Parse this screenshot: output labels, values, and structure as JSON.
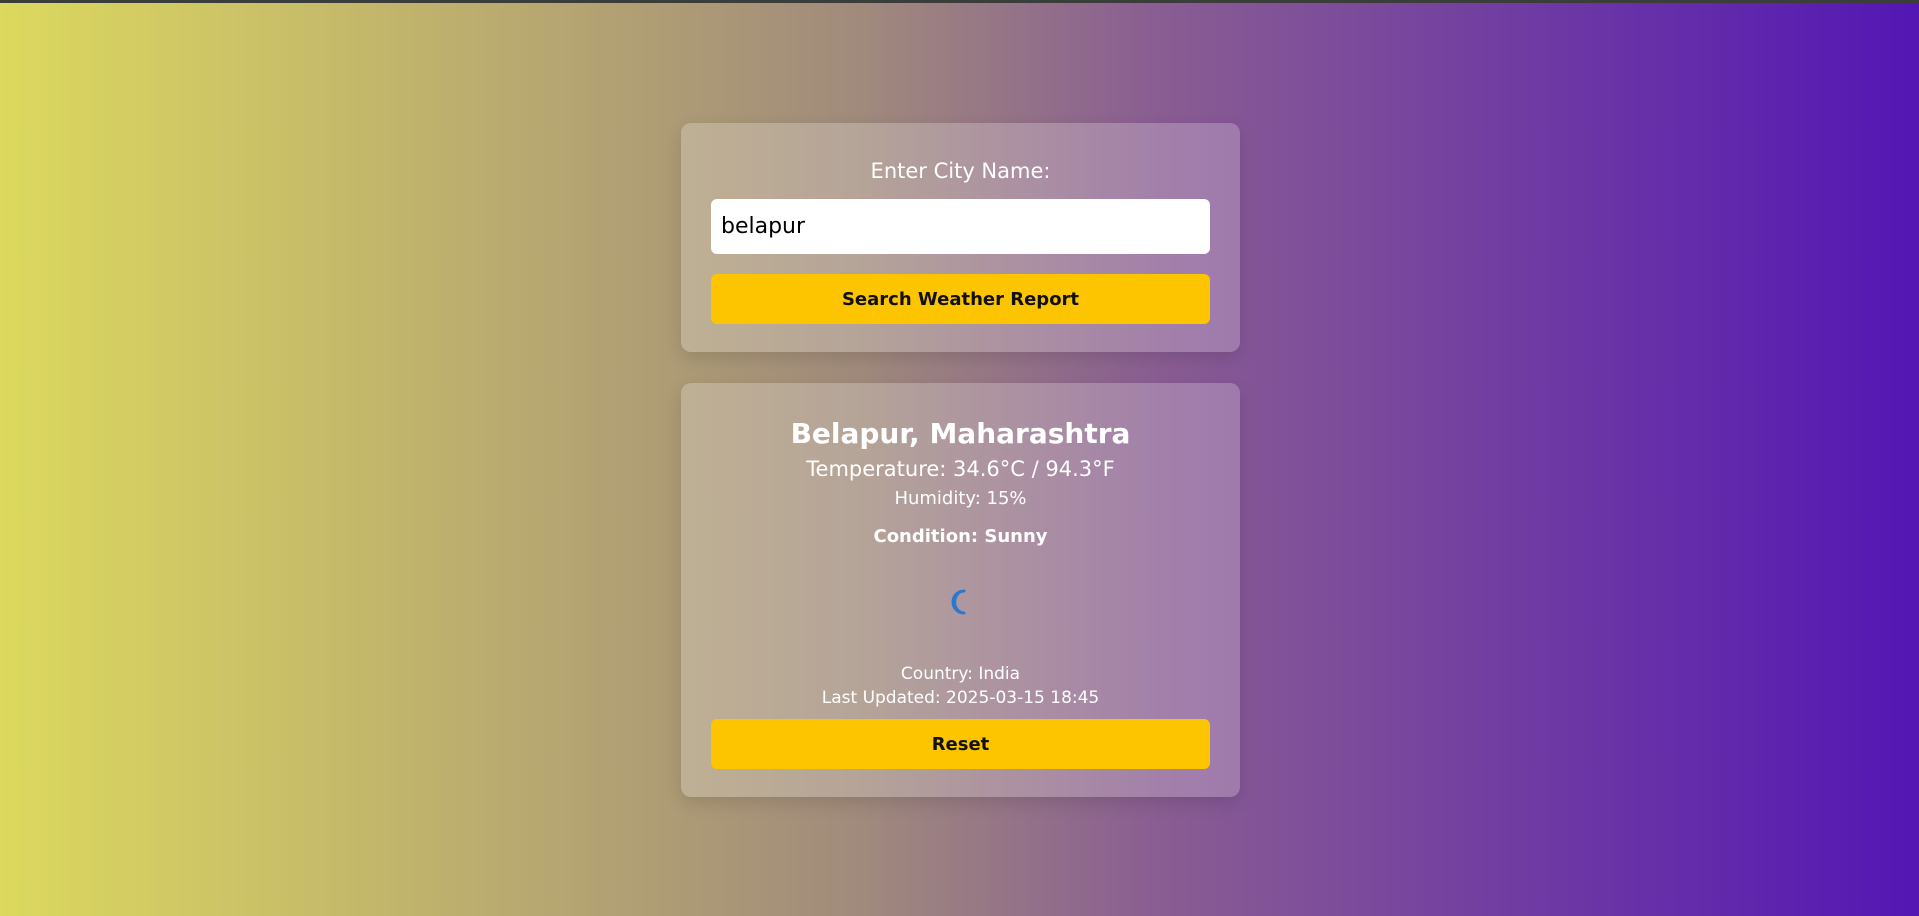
{
  "search": {
    "label": "Enter City Name:",
    "input_value": "belapur",
    "button_label": "Search Weather Report"
  },
  "result": {
    "city": "Belapur, Maharashtra",
    "temperature": "Temperature: 34.6°C / 94.3°F",
    "humidity": "Humidity: 15%",
    "condition": "Condition: Sunny",
    "condition_icon": "crescent-moon-icon",
    "country": "Country: India",
    "last_updated": "Last Updated: 2025-03-15 18:45",
    "reset_label": "Reset"
  },
  "colors": {
    "gradient_start": "#dcd95e",
    "gradient_end": "#5416b4",
    "button": "#fdc500",
    "icon_blue": "#2b78d0"
  }
}
